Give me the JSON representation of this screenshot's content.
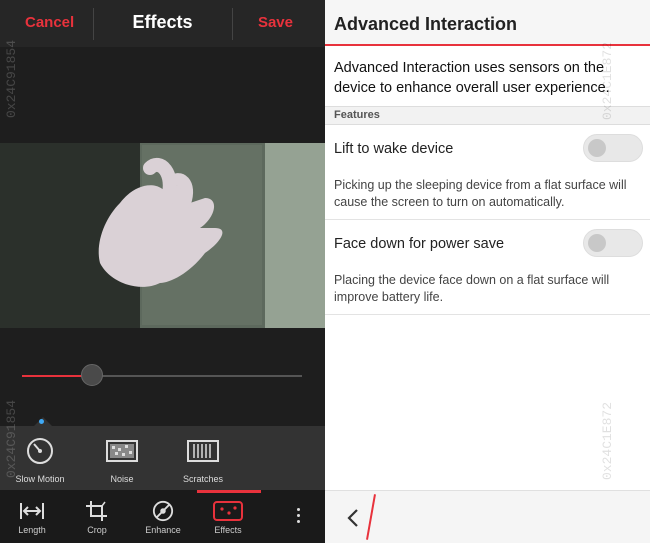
{
  "editor": {
    "cancel_label": "Cancel",
    "title": "Effects",
    "save_label": "Save",
    "slider_value": 0.25,
    "effects": [
      {
        "label": "Slow Motion",
        "icon": "speedometer-icon"
      },
      {
        "label": "Noise",
        "icon": "noise-icon"
      },
      {
        "label": "Scratches",
        "icon": "scratches-icon"
      }
    ],
    "tabs": [
      {
        "label": "Length",
        "icon": "length-icon"
      },
      {
        "label": "Crop",
        "icon": "crop-icon"
      },
      {
        "label": "Enhance",
        "icon": "enhance-icon"
      },
      {
        "label": "Effects",
        "icon": "effects-icon",
        "active": true
      }
    ],
    "more_icon": "more-vertical-icon",
    "watermark": "0x24C91854"
  },
  "settings": {
    "title": "Advanced Interaction",
    "intro": "Advanced Interaction uses sensors on the device to enhance overall user experience.",
    "section_label": "Features",
    "items": [
      {
        "label": "Lift to wake device",
        "enabled": false,
        "description": "Picking up the sleeping device from a flat surface will cause the screen to turn on automatically."
      },
      {
        "label": "Face down for power save",
        "enabled": false,
        "description": "Placing the device face down on a flat surface will improve battery life."
      }
    ],
    "back_icon": "back-chevron-icon",
    "watermark": "0x24C1E872"
  },
  "colors": {
    "accent": "#e8323c",
    "left_bg": "#1e1e1e",
    "right_bg": "#ffffff",
    "indicator_dot": "#3fa9f5"
  }
}
